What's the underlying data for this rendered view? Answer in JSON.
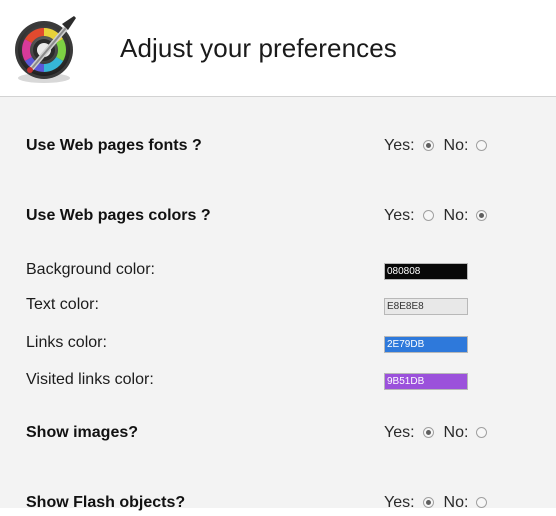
{
  "header": {
    "title": "Adjust your preferences",
    "icon": "color-picker-icon"
  },
  "preferences": {
    "web_fonts": {
      "label": "Use Web pages fonts ?",
      "yes_label": "Yes:",
      "no_label": "No:",
      "selected": "yes"
    },
    "web_colors": {
      "label": "Use Web pages colors ?",
      "yes_label": "Yes:",
      "no_label": "No:",
      "selected": "no"
    },
    "colors": [
      {
        "label": "Background color:",
        "value": "080808",
        "hex": "#080808"
      },
      {
        "label": "Text color:",
        "value": "E8E8E8",
        "hex": "#E8E8E8"
      },
      {
        "label": "Links color:",
        "value": "2E79DB",
        "hex": "#2E79DB"
      },
      {
        "label": "Visited links color:",
        "value": "9B51DB",
        "hex": "#9B51DB"
      }
    ],
    "show_images": {
      "label": "Show images?",
      "yes_label": "Yes:",
      "no_label": "No:",
      "selected": "yes"
    },
    "show_flash": {
      "label": "Show Flash objects?",
      "yes_label": "Yes:",
      "no_label": "No:",
      "selected": "yes"
    }
  }
}
